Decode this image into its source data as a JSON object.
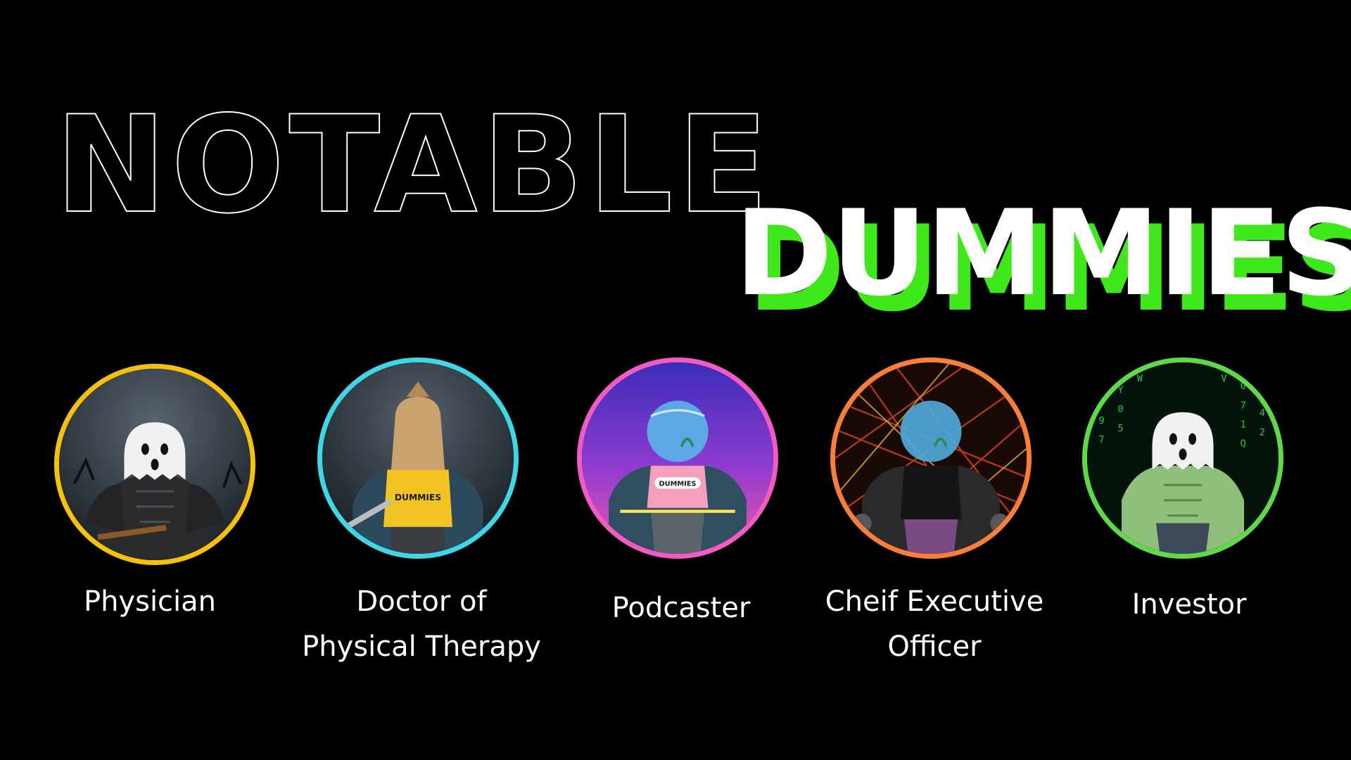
{
  "title": {
    "outline_word": "NOTABLE",
    "fill_word": "DUMMIES",
    "fill_color": "#ffffff",
    "shadow_color": "#3ee81a"
  },
  "members": [
    {
      "label": "Physician",
      "ring_color": "#f5c10e",
      "background": "stormy-night",
      "head": "ghost-head"
    },
    {
      "label": "Doctor of\nPhysical Therapy",
      "ring_color": "#3fd6e6",
      "background": "stormy-night",
      "head": "sack-head"
    },
    {
      "label": "Podcaster",
      "ring_color": "#f25bc4",
      "background": "purple-pink-gradient",
      "head": "fishbowl-head"
    },
    {
      "label": "Cheif Executive\nOfficer",
      "ring_color": "#f77f3a",
      "background": "tangled-lines",
      "head": "fishbowl-head"
    },
    {
      "label": "Investor",
      "ring_color": "#5fd94a",
      "background": "matrix-code",
      "head": "ghost-head"
    }
  ]
}
